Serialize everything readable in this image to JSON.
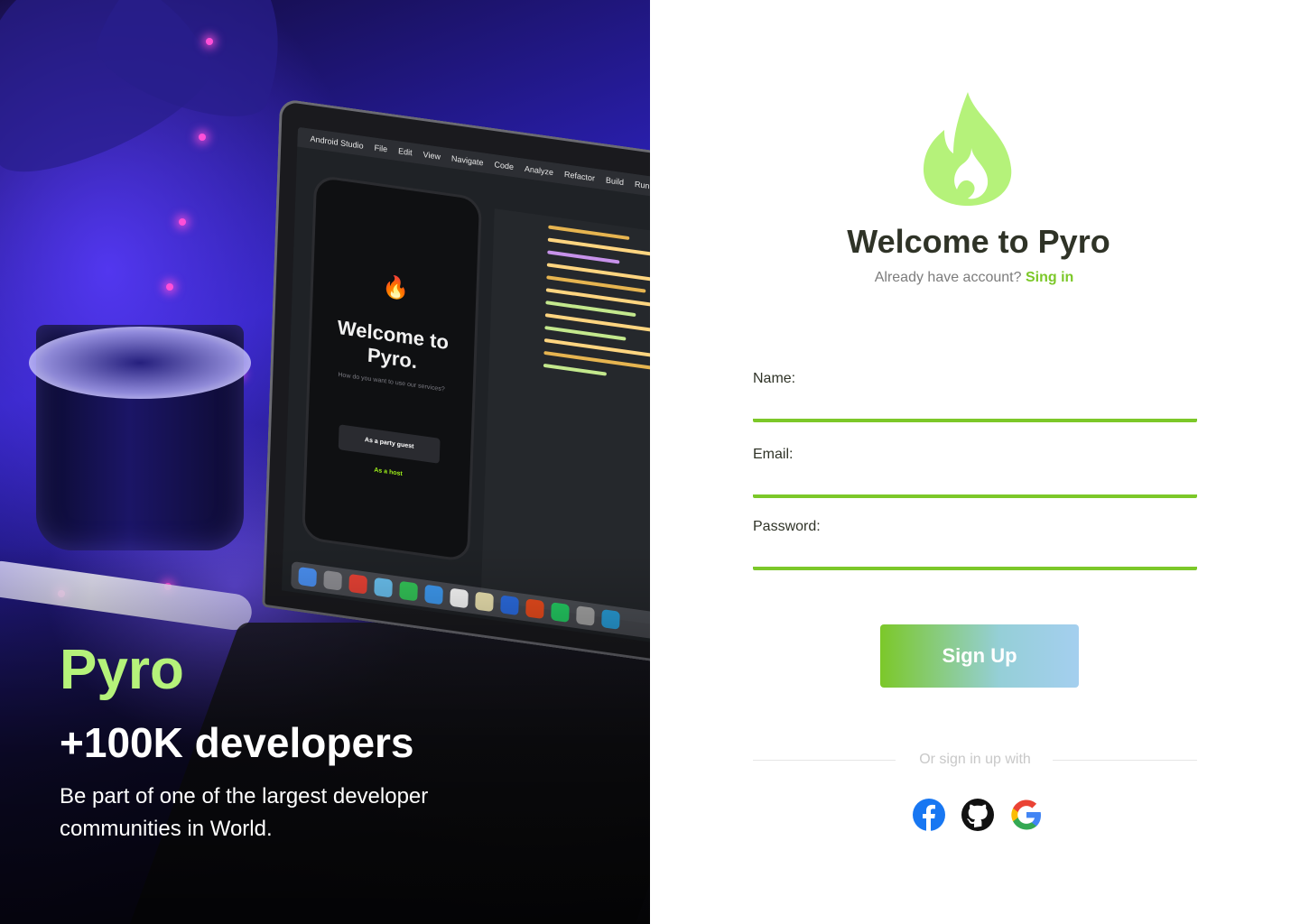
{
  "hero": {
    "brand": "Pyro",
    "headline": "+100K developers",
    "tagline": "Be part of one of the largest developer communities in World.",
    "laptop_menu": [
      "Android Studio",
      "File",
      "Edit",
      "View",
      "Navigate",
      "Code",
      "Analyze",
      "Refactor",
      "Build",
      "Run"
    ],
    "phone_title": "Welcome to Pyro.",
    "phone_subtitle": "How do you want to use our services?",
    "phone_button": "As a party guest",
    "phone_link": "As a host"
  },
  "header": {
    "title": "Welcome to Pyro",
    "already_text": "Already have account?",
    "signin_link": "Sing in"
  },
  "form": {
    "name_label": "Name:",
    "email_label": "Email:",
    "password_label": "Password:",
    "signup_label": "Sign Up"
  },
  "divider": {
    "text": "Or sign in up with"
  },
  "social": [
    {
      "name": "facebook-icon"
    },
    {
      "name": "github-icon"
    },
    {
      "name": "google-icon"
    }
  ],
  "colors": {
    "accent": "#7cc829",
    "logo": "#b5f27a",
    "title": "#2f3327",
    "muted": "#7c7c7c"
  }
}
